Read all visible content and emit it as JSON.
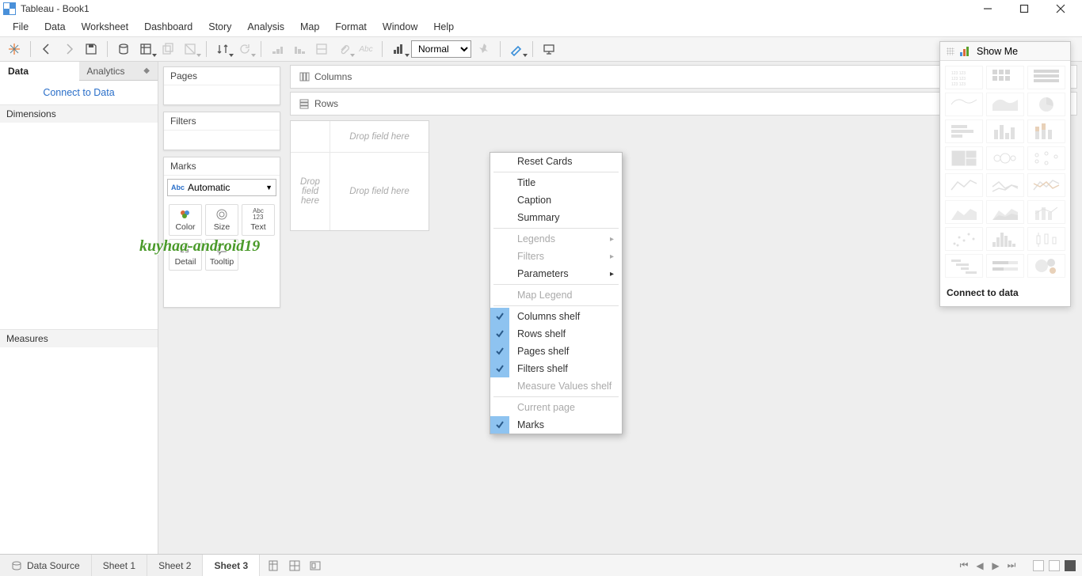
{
  "title": "Tableau - Book1",
  "menu": [
    "File",
    "Data",
    "Worksheet",
    "Dashboard",
    "Story",
    "Analysis",
    "Map",
    "Format",
    "Window",
    "Help"
  ],
  "toolbar": {
    "fit_mode": "Normal"
  },
  "left": {
    "tabs": {
      "data": "Data",
      "analytics": "Analytics"
    },
    "connect": "Connect to Data",
    "dimensions": "Dimensions",
    "measures": "Measures"
  },
  "cards": {
    "pages": "Pages",
    "filters": "Filters",
    "marks": "Marks",
    "mark_type": "Automatic",
    "mark_cells": [
      "Color",
      "Size",
      "Text",
      "Detail",
      "Tooltip"
    ]
  },
  "shelves": {
    "columns": "Columns",
    "rows": "Rows",
    "drop_top": "Drop field here",
    "drop_left": "Drop field here",
    "drop_main": "Drop field here"
  },
  "context_menu": {
    "reset": "Reset Cards",
    "title": "Title",
    "caption": "Caption",
    "summary": "Summary",
    "legends": "Legends",
    "filters": "Filters",
    "parameters": "Parameters",
    "map_legend": "Map Legend",
    "columns_shelf": "Columns shelf",
    "rows_shelf": "Rows shelf",
    "pages_shelf": "Pages shelf",
    "filters_shelf": "Filters shelf",
    "measure_values": "Measure Values shelf",
    "current_page": "Current page",
    "marks": "Marks"
  },
  "showme": {
    "title": "Show Me",
    "footer": "Connect to data"
  },
  "bottom": {
    "data_source": "Data Source",
    "sheets": [
      "Sheet 1",
      "Sheet 2",
      "Sheet 3"
    ],
    "active_sheet": "Sheet 3"
  },
  "watermark": "kuyhaa-android19"
}
